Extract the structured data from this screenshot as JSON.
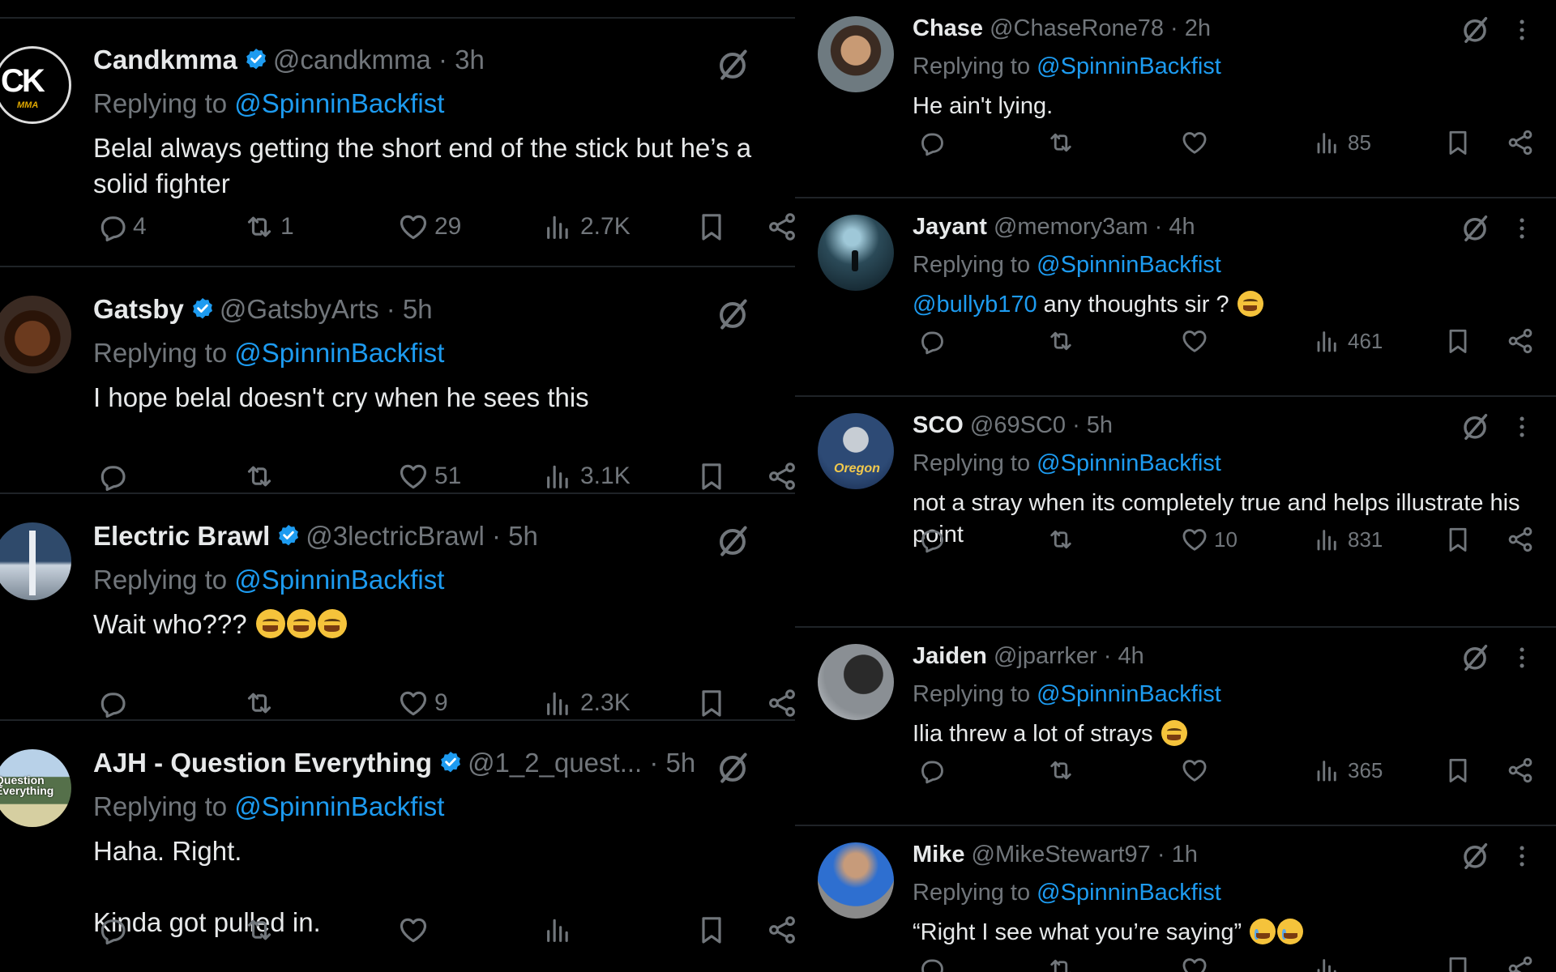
{
  "colors": {
    "background": "#000000",
    "text": "#e7e9ea",
    "muted": "#71767b",
    "link": "#1d9bf0",
    "verified": "#1d9bf0",
    "divider": "#1f2327"
  },
  "left_column": [
    {
      "name": "Candkmma",
      "handle": "@candkmma",
      "time": "· 3h",
      "verified": true,
      "replying_prefix": "Replying to",
      "replying_to": "@SpinninBackfist",
      "text": "Belal always getting the short end of the stick but he’s a\nsolid fighter",
      "emojis": 0,
      "avatar": {
        "label": "CK",
        "sublabel": "MMA"
      },
      "replies": "4",
      "reposts": "1",
      "likes": "29",
      "views": "2.7K"
    },
    {
      "name": "Gatsby",
      "handle": "@GatsbyArts",
      "time": "· 5h",
      "verified": true,
      "replying_prefix": "Replying to",
      "replying_to": "@SpinninBackfist",
      "text": "I hope belal doesn't cry when he sees this",
      "emojis": 0,
      "replies": "",
      "reposts": "",
      "likes": "51",
      "views": "3.1K"
    },
    {
      "name": "Electric Brawl",
      "handle": "@3lectricBrawl",
      "time": "· 5h",
      "verified": true,
      "replying_prefix": "Replying to",
      "replying_to": "@SpinninBackfist",
      "text": "Wait who??? ",
      "emojis": 3,
      "replies": "",
      "reposts": "",
      "likes": "9",
      "views": "2.3K"
    },
    {
      "name": "AJH - Question Everything",
      "handle": "@1_2_quest...",
      "time": "· 5h",
      "verified": true,
      "replying_prefix": "Replying to",
      "replying_to": "@SpinninBackfist",
      "text": "Haha. Right.\n\nKinda got pulled in.",
      "emojis": 0,
      "avatar": {
        "label": "Question\nEverything"
      },
      "replies": "",
      "reposts": "",
      "likes": "",
      "views": ""
    }
  ],
  "right_column": [
    {
      "name": "Chase",
      "handle": "@ChaseRone78",
      "time": "· 2h",
      "verified": false,
      "replying_prefix": "Replying to",
      "replying_to": "@SpinninBackfist",
      "text": "He ain't lying.",
      "mention": "",
      "emojis": 0,
      "replies": "",
      "reposts": "",
      "likes": "",
      "views": "85"
    },
    {
      "name": "Jayant",
      "handle": "@memory3am",
      "time": "· 4h",
      "verified": false,
      "replying_prefix": "Replying to",
      "replying_to": "@SpinninBackfist",
      "mention": "@bullyb170",
      "text": " any thoughts sir ? ",
      "emojis": 1,
      "replies": "",
      "reposts": "",
      "likes": "",
      "views": "461"
    },
    {
      "name": "SCO",
      "handle": "@69SC0",
      "time": "· 5h",
      "verified": false,
      "replying_prefix": "Replying to",
      "replying_to": "@SpinninBackfist",
      "mention": "",
      "text": "not a stray when its completely true and helps illustrate his\npoint",
      "emojis": 0,
      "avatar": {
        "label": "Oregon"
      },
      "replies": "",
      "reposts": "",
      "likes": "10",
      "views": "831"
    },
    {
      "name": "Jaiden",
      "handle": "@jparrker",
      "time": "· 4h",
      "verified": false,
      "replying_prefix": "Replying to",
      "replying_to": "@SpinninBackfist",
      "mention": "",
      "text": "Ilia threw a lot of strays ",
      "emojis": 1,
      "replies": "",
      "reposts": "",
      "likes": "",
      "views": "365"
    },
    {
      "name": "Mike",
      "handle": "@MikeStewart97",
      "time": "· 1h",
      "verified": false,
      "replying_prefix": "Replying to",
      "replying_to": "@SpinninBackfist",
      "mention": "",
      "text": "“Right I see what you’re saying” ",
      "emojis": 2,
      "emoji_kind": "cry",
      "replies": "",
      "reposts": "",
      "likes": "",
      "views": ""
    }
  ]
}
